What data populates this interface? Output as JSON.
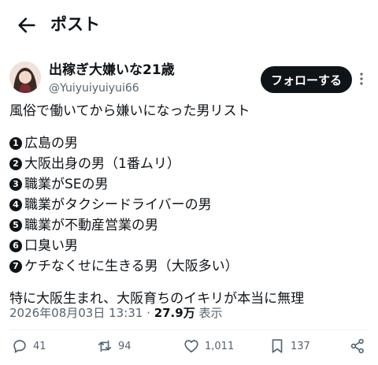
{
  "header": {
    "title": "ポスト"
  },
  "author": {
    "name": "出稼ぎ大嫌いな21歳",
    "handle": "@Yuiyuiyuiyui66",
    "follow_label": "フォローする"
  },
  "post": {
    "intro": "風俗で働いてから嫌いになった男リスト",
    "items": [
      {
        "num": "1",
        "text": "広島の男"
      },
      {
        "num": "2",
        "text": "大阪出身の男（1番ムリ）"
      },
      {
        "num": "3",
        "text": "職業がSEの男"
      },
      {
        "num": "4",
        "text": "職業がタクシードライバーの男"
      },
      {
        "num": "5",
        "text": "職業が不動産営業の男"
      },
      {
        "num": "6",
        "text": "口臭い男"
      },
      {
        "num": "7",
        "text": "ケチなくせに生きる男（大阪多い）"
      }
    ],
    "closing": "特に大阪生まれ、大阪育ちのイキリが本当に無理",
    "timestamp": "2026年08月03日 13:31",
    "separator": "·",
    "views": "27.9万",
    "views_label": "表示"
  },
  "actions": {
    "replies": "41",
    "reposts": "94",
    "likes": "1,011",
    "bookmarks": "137"
  },
  "icons": [
    "back-arrow-icon",
    "more-icon",
    "reply-icon",
    "repost-icon",
    "like-icon",
    "bookmark-icon",
    "share-icon"
  ],
  "colors": {
    "text": "#0f1419",
    "secondary": "#536471",
    "button": "#0f1419"
  }
}
